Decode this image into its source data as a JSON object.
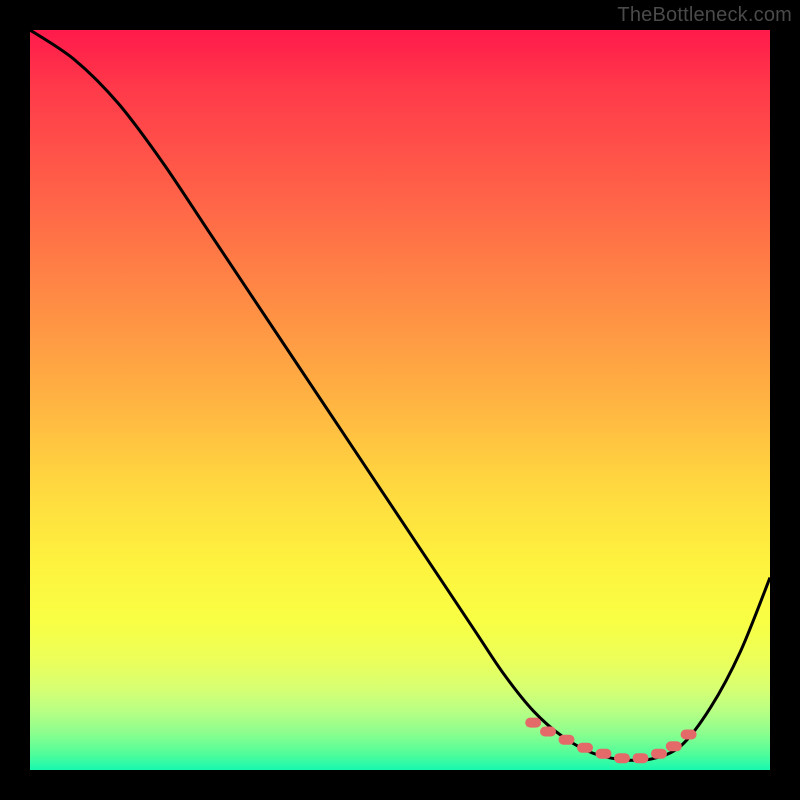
{
  "watermark": "TheBottleneck.com",
  "gradient_colors": {
    "top": "#ff1a4b",
    "mid_upper": "#ff8a45",
    "mid": "#ffd93f",
    "mid_lower": "#f8ff44",
    "bottom": "#17f8b0"
  },
  "curve_color": "#000000",
  "marker_color": "#e46a6a",
  "chart_data": {
    "type": "line",
    "title": "",
    "xlabel": "",
    "ylabel": "",
    "xlim": [
      0,
      100
    ],
    "ylim": [
      0,
      100
    ],
    "series": [
      {
        "name": "bottleneck-curve",
        "x": [
          0,
          6,
          12,
          18,
          24,
          30,
          36,
          42,
          48,
          54,
          60,
          64,
          68,
          72,
          76,
          80,
          84,
          88,
          92,
          96,
          100
        ],
        "y": [
          100,
          96,
          90,
          82,
          73,
          64,
          55,
          46,
          37,
          28,
          19,
          13,
          8,
          4.5,
          2.3,
          1.4,
          1.5,
          3.3,
          8.5,
          16,
          26
        ]
      }
    ],
    "markers": {
      "name": "optimal-range",
      "x": [
        68,
        70,
        72.5,
        75,
        77.5,
        80,
        82.5,
        85,
        87,
        89
      ],
      "y": [
        6.4,
        5.2,
        4.1,
        3.0,
        2.2,
        1.6,
        1.6,
        2.2,
        3.2,
        4.8
      ]
    }
  }
}
